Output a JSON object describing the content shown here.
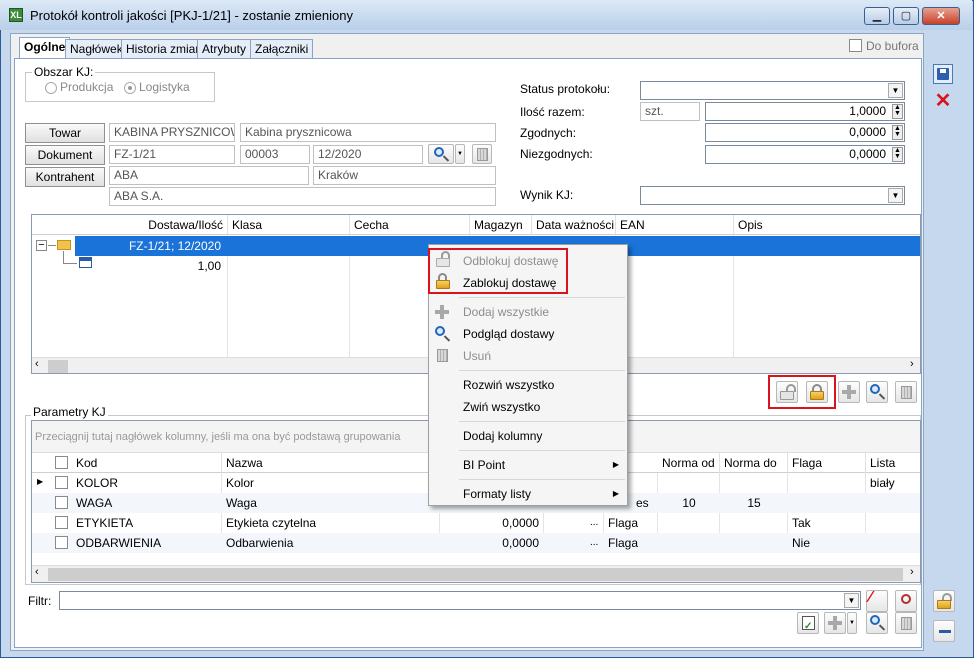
{
  "window": {
    "title": "Protokół kontroli jakości [PKJ-1/21] - zostanie zmieniony",
    "icon_label": "XL"
  },
  "tabs": [
    "Ogólne",
    "Nagłówek",
    "Historia zmian",
    "Atrybuty",
    "Załączniki"
  ],
  "do_bufora": "Do bufora",
  "obszar": {
    "label": "Obszar KJ:",
    "produkcja": "Produkcja",
    "logistyka": "Logistyka"
  },
  "status": {
    "label": "Status protokołu:",
    "value": ""
  },
  "ilosc": {
    "label": "Ilość razem:",
    "unit": "szt.",
    "value": "1,0000"
  },
  "zgodnych": {
    "label": "Zgodnych:",
    "value": "0,0000"
  },
  "niezgodnych": {
    "label": "Niezgodnych:",
    "value": "0,0000"
  },
  "wynik": {
    "label": "Wynik KJ:",
    "value": ""
  },
  "towar": {
    "button": "Towar",
    "code": "KABINA PRYSZNICOWA",
    "name": "Kabina prysznicowa"
  },
  "dokument": {
    "button": "Dokument",
    "number": "FZ-1/21",
    "seq": "00003",
    "period": "12/2020"
  },
  "kontrahent": {
    "button": "Kontrahent",
    "code": "ABA",
    "city": "Kraków",
    "name": "ABA S.A."
  },
  "deliveries": {
    "headers": [
      "Dostawa/Ilość",
      "Klasa",
      "Cecha",
      "Magazyn",
      "Data ważności",
      "EAN",
      "Opis"
    ],
    "rows": [
      {
        "label": "FZ-1/21; 12/2020"
      },
      {
        "label": "1,00"
      }
    ]
  },
  "context_menu": {
    "unlock": "Odblokuj dostawę",
    "lock": "Zablokuj dostawę",
    "add_all": "Dodaj wszystkie",
    "preview": "Podgląd dostawy",
    "remove": "Usuń",
    "expand": "Rozwiń wszystko",
    "collapse": "Zwiń wszystko",
    "add_columns": "Dodaj kolumny",
    "bi_point": "BI Point",
    "formats": "Formaty listy"
  },
  "params": {
    "label": "Parametry KJ",
    "group_hint": "Przeciągnij tutaj nagłówek kolumny, jeśli ma ona być podstawą grupowania",
    "headers": [
      "Kod",
      "Nazwa",
      "Norma od",
      "Norma do",
      "Flaga",
      "Lista"
    ],
    "rows": [
      {
        "kod": "KOLOR",
        "nazwa": "Kolor",
        "wartosc": "",
        "typ": "",
        "norma_od": "",
        "norma_do": "",
        "flaga": "",
        "lista": "biały"
      },
      {
        "kod": "WAGA",
        "nazwa": "Waga",
        "wartosc": "",
        "typ": "es",
        "norma_od": "10",
        "norma_do": "15",
        "flaga": "",
        "lista": ""
      },
      {
        "kod": "ETYKIETA",
        "nazwa": "Etykieta czytelna",
        "wartosc": "0,0000",
        "typ": "Flaga",
        "norma_od": "",
        "norma_do": "",
        "flaga": "Tak",
        "lista": ""
      },
      {
        "kod": "ODBARWIENIA",
        "nazwa": "Odbarwienia",
        "wartosc": "0,0000",
        "typ": "Flaga",
        "norma_od": "",
        "norma_do": "",
        "flaga": "Nie",
        "lista": ""
      }
    ]
  },
  "filter": {
    "label": "Filtr:",
    "value": ""
  },
  "colors": {
    "selection": "#1a73d8",
    "highlight": "#d9141f",
    "accent": "#2a5a92"
  }
}
